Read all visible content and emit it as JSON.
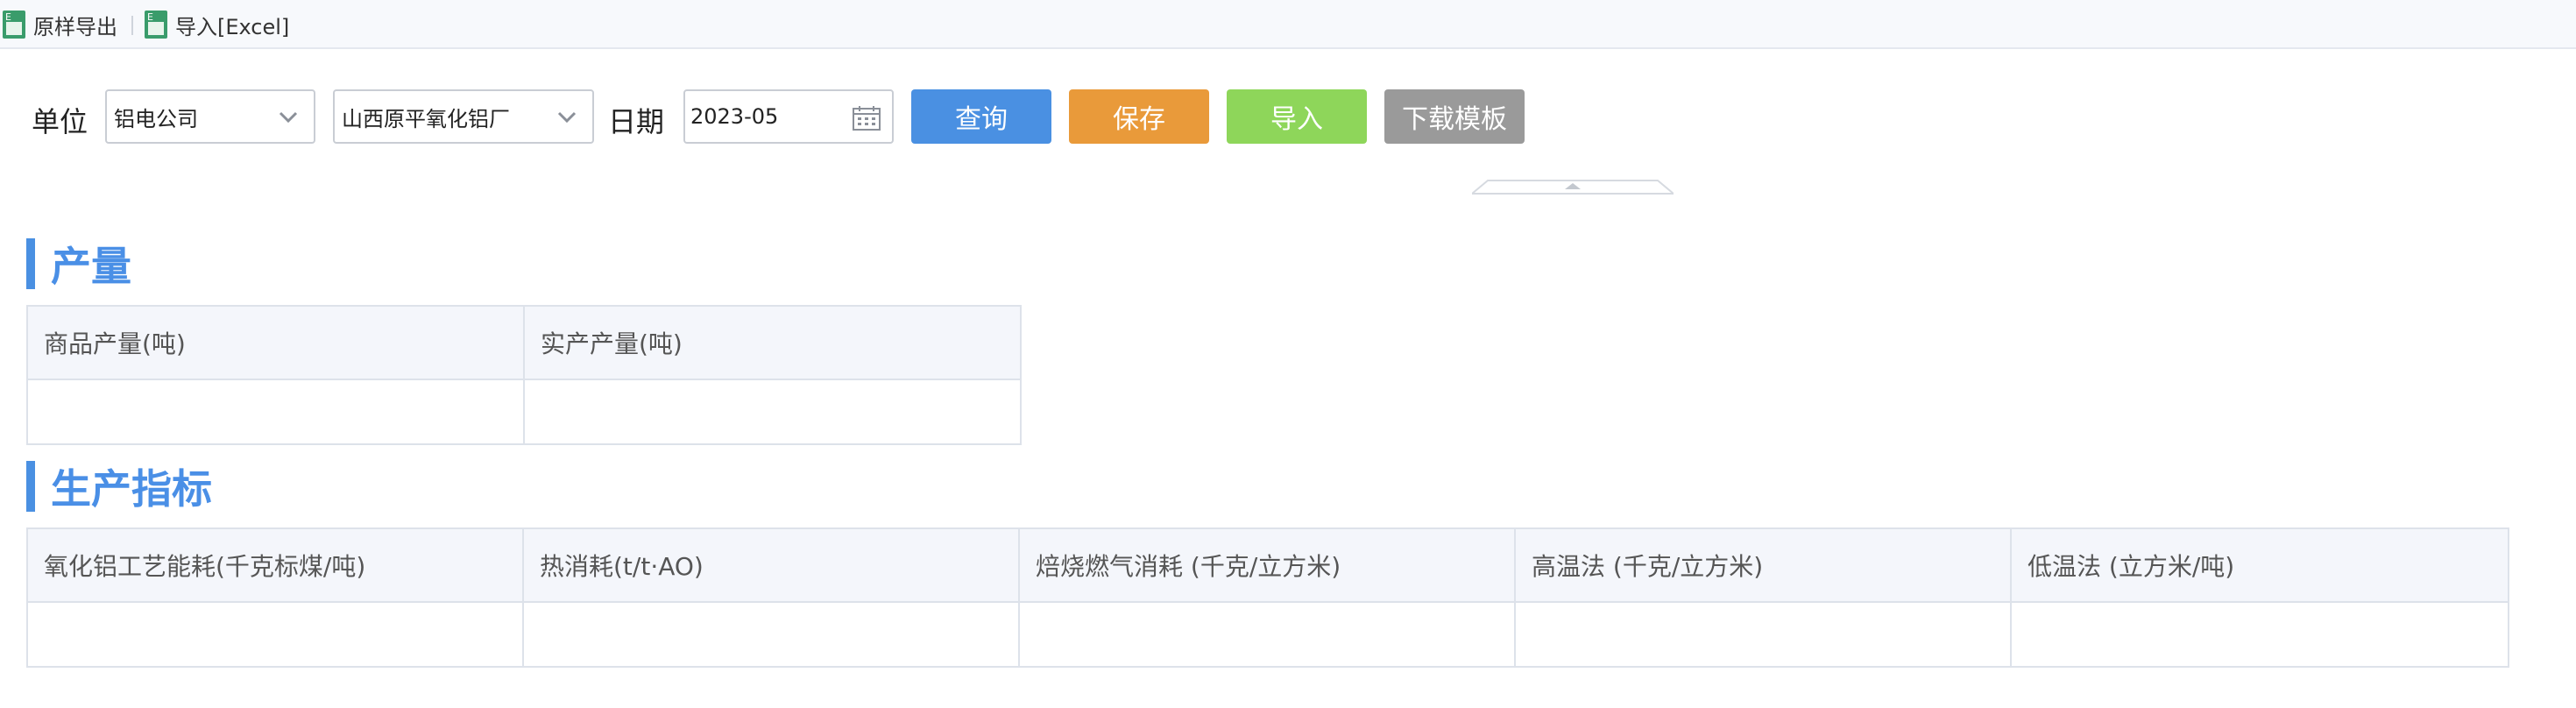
{
  "toolbar": {
    "export_label": "原样导出",
    "import_label": "导入[Excel]"
  },
  "filters": {
    "unit_label": "单位",
    "unit_value": "铝电公司",
    "factory_value": "山西原平氧化铝厂",
    "date_label": "日期",
    "date_value": "2023-05"
  },
  "buttons": {
    "query": "查询",
    "save": "保存",
    "import": "导入",
    "download": "下载模板"
  },
  "colors": {
    "query": "#4a90e2",
    "save": "#e99a3a",
    "import": "#8ed65a",
    "download": "#9a9a9a",
    "accent": "#4a8fe6"
  },
  "sections": {
    "production": {
      "title": "产量",
      "columns": [
        "商品产量(吨)",
        "实产产量(吨)"
      ]
    },
    "indicators": {
      "title": "生产指标",
      "columns": [
        "氧化铝工艺能耗(千克标煤/吨)",
        "热消耗(t/t·AO)",
        "焙烧燃气消耗 (千克/立方米)",
        "高温法 (千克/立方米)",
        "低温法 (立方米/吨)"
      ]
    }
  }
}
